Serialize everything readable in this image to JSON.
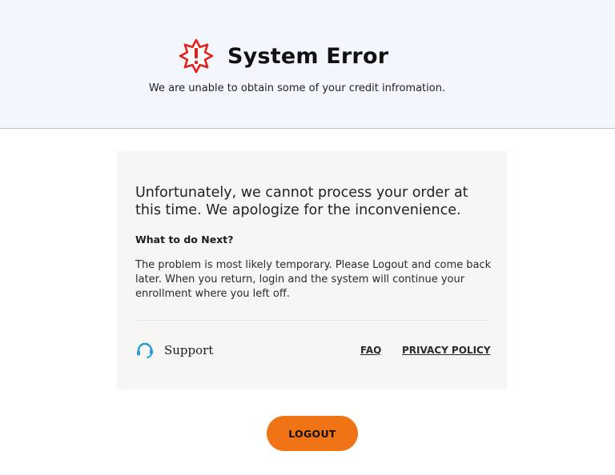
{
  "colors": {
    "header_bg": "#f3f6fc",
    "alert_red": "#e3201b",
    "card_bg": "#f8f6f5",
    "support_blue": "#2a9fd6",
    "button_orange": "#f07415"
  },
  "header": {
    "icon": "alert-burst-icon",
    "title": "System Error",
    "subtitle": "We are unable to obtain some of your credit infromation."
  },
  "card": {
    "heading": "Unfortunately, we cannot process your order at this time. We apologize for the inconvenience.",
    "next_title": "What to do Next?",
    "next_body": "The problem is most likely temporary. Please Logout and come back later. When you return, login and the system will continue your enrollment where you left off.",
    "footer": {
      "support_icon": "headset-icon",
      "support_label": "Support",
      "faq_label": "FAQ",
      "privacy_label": "PRIVACY POLICY"
    }
  },
  "logout_label": "LOGOUT"
}
